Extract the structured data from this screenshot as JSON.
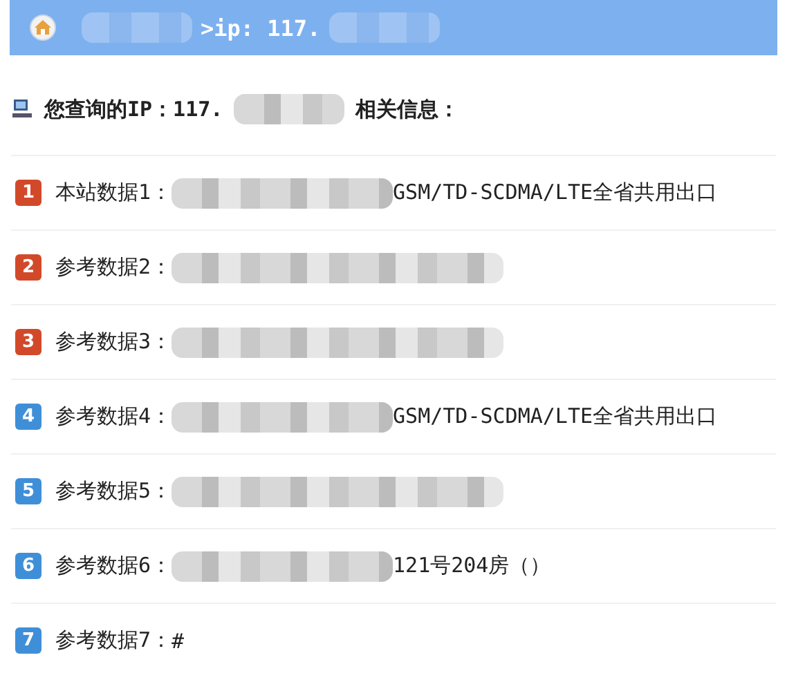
{
  "header": {
    "segments": [
      {
        "kind": "redacted"
      },
      {
        "kind": "text",
        "text": ">ip: 117."
      },
      {
        "kind": "redacted"
      }
    ]
  },
  "heading": {
    "segments": [
      {
        "kind": "text",
        "text": "您查询的IP：117."
      },
      {
        "kind": "redacted"
      },
      {
        "kind": "text",
        "text": "相关信息："
      }
    ]
  },
  "rows": [
    {
      "number": "1",
      "color": "#d2492a",
      "label": "本站数据1：",
      "segments": [
        {
          "kind": "redacted"
        },
        {
          "kind": "text",
          "text": "GSM/TD-SCDMA/LTE全省共用出口"
        }
      ]
    },
    {
      "number": "2",
      "color": "#d2492a",
      "label": "参考数据2：",
      "segments": [
        {
          "kind": "redacted"
        }
      ]
    },
    {
      "number": "3",
      "color": "#d2492a",
      "label": "参考数据3：",
      "segments": [
        {
          "kind": "redacted"
        }
      ]
    },
    {
      "number": "4",
      "color": "#3f8fd8",
      "label": "参考数据4：",
      "segments": [
        {
          "kind": "redacted"
        },
        {
          "kind": "text",
          "text": "GSM/TD-SCDMA/LTE全省共用出口"
        }
      ]
    },
    {
      "number": "5",
      "color": "#3f8fd8",
      "label": "参考数据5：",
      "segments": [
        {
          "kind": "redacted"
        }
      ]
    },
    {
      "number": "6",
      "color": "#3f8fd8",
      "label": "参考数据6：",
      "segments": [
        {
          "kind": "redacted"
        },
        {
          "kind": "text",
          "text": "121号204房（）"
        }
      ]
    },
    {
      "number": "7",
      "color": "#3f8fd8",
      "label": "参考数据7：",
      "segments": [
        {
          "kind": "text",
          "text": "#"
        }
      ]
    }
  ]
}
